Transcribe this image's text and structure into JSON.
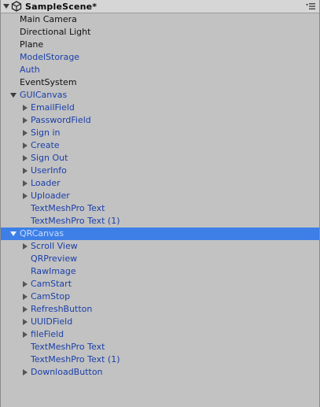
{
  "scene": {
    "title": "SampleScene*"
  },
  "objects": {
    "main_camera": "Main Camera",
    "directional_light": "Directional Light",
    "plane": "Plane",
    "model_storage": "ModelStorage",
    "auth": "Auth",
    "event_system": "EventSystem",
    "gui_canvas": "GUICanvas",
    "gui_children": {
      "email_field": "EmailField",
      "password_field": "PasswordField",
      "sign_in": "Sign in",
      "create": "Create",
      "sign_out": "Sign Out",
      "user_info": "UserInfo",
      "loader": "Loader",
      "uploader": "Uploader",
      "tmp_text": "TextMeshPro Text",
      "tmp_text_1": "TextMeshPro Text (1)"
    },
    "qr_canvas": "QRCanvas",
    "qr_children": {
      "scroll_view": "Scroll View",
      "qr_preview": "QRPreview",
      "raw_image": "RawImage",
      "cam_start": "CamStart",
      "cam_stop": "CamStop",
      "refresh_button": "RefreshButton",
      "uuid_field": "UUIDField",
      "file_field": "fileField",
      "tmp_text": "TextMeshPro Text",
      "tmp_text_1": "TextMeshPro Text (1)",
      "download_button": "DownloadButton"
    }
  },
  "colors": {
    "background": "#c2c2c2",
    "selection": "#3d7fe6",
    "prefab_text": "#1a3fa8",
    "normal_text": "#111111"
  },
  "icons": {
    "scene": "unity-logo-icon",
    "menu": "hamburger-menu-icon",
    "expand": "triangle-right-icon",
    "collapse": "triangle-down-icon"
  }
}
